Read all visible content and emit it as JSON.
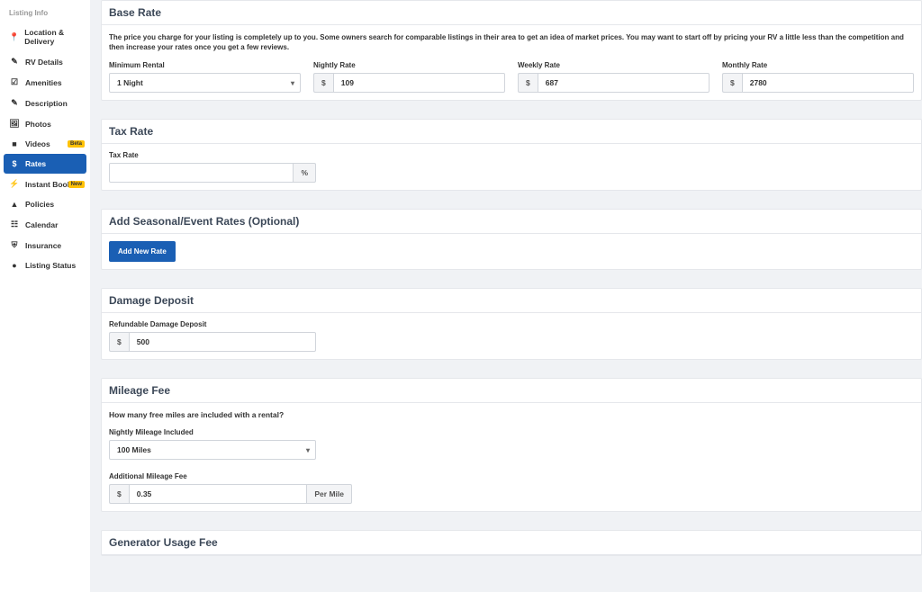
{
  "sidebar": {
    "header": "Listing Info",
    "items": [
      {
        "label": "Location & Delivery"
      },
      {
        "label": "RV Details"
      },
      {
        "label": "Amenities"
      },
      {
        "label": "Description"
      },
      {
        "label": "Photos"
      },
      {
        "label": "Videos",
        "badge": "Beta"
      },
      {
        "label": "Rates"
      },
      {
        "label": "Instant Book",
        "badge": "New"
      },
      {
        "label": "Policies"
      },
      {
        "label": "Calendar"
      },
      {
        "label": "Insurance"
      },
      {
        "label": "Listing Status"
      }
    ]
  },
  "base_rate": {
    "title": "Base Rate",
    "desc": "The price you charge for your listing is completely up to you. Some owners search for comparable listings in their area to get an idea of market prices. You may want to start off by pricing your RV a little less than the competition and then increase your rates once you get a few reviews.",
    "min_rental_label": "Minimum Rental",
    "min_rental_value": "1 Night",
    "nightly_label": "Nightly Rate",
    "nightly_value": "109",
    "weekly_label": "Weekly Rate",
    "weekly_value": "687",
    "monthly_label": "Monthly Rate",
    "monthly_value": "2780",
    "currency": "$"
  },
  "tax_rate": {
    "title": "Tax Rate",
    "label": "Tax Rate",
    "value": "",
    "suffix": "%"
  },
  "seasonal": {
    "title": "Add Seasonal/Event Rates (Optional)",
    "button": "Add New Rate"
  },
  "damage_deposit": {
    "title": "Damage Deposit",
    "label": "Refundable Damage Deposit",
    "value": "500",
    "currency": "$"
  },
  "mileage": {
    "title": "Mileage Fee",
    "question": "How many free miles are included with a rental?",
    "nightly_label": "Nightly Mileage Included",
    "nightly_value": "100 Miles",
    "additional_label": "Additional Mileage Fee",
    "additional_value": "0.35",
    "currency": "$",
    "suffix": "Per Mile"
  },
  "generator": {
    "title": "Generator Usage Fee"
  }
}
